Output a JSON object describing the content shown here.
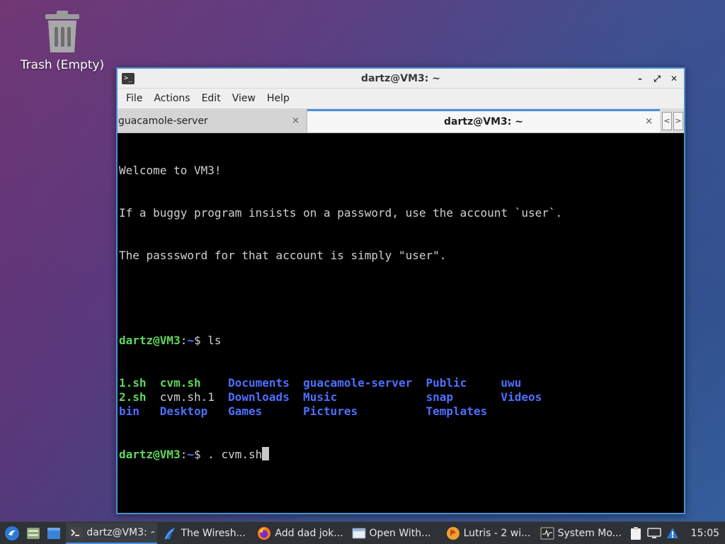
{
  "desktop": {
    "icons": [
      {
        "label": "Trash (Empty)",
        "icon": "trash-icon"
      }
    ]
  },
  "window": {
    "title": "dartz@VM3: ~",
    "controls": [
      "minimize",
      "maximize",
      "close"
    ],
    "menu": [
      "File",
      "Actions",
      "Edit",
      "View",
      "Help"
    ],
    "tabs": [
      {
        "label": "guacamole-server",
        "active": false
      },
      {
        "label": "dartz@VM3: ~",
        "active": true
      }
    ]
  },
  "terminal": {
    "welcome": [
      "Welcome to VM3!",
      "If a buggy program insists on a password, use the account `user`.",
      "The passsword for that account is simply \"user\"."
    ],
    "prompt_user": "dartz@VM3",
    "prompt_sep": ":",
    "prompt_path": "~",
    "prompt_symbol": "$ ",
    "command1": "ls",
    "ls_rows": [
      [
        {
          "t": "1.sh",
          "k": "exe"
        },
        {
          "t": "cvm.sh",
          "k": "exe"
        },
        {
          "t": "Documents",
          "k": "dir"
        },
        {
          "t": "guacamole-server",
          "k": "dir"
        },
        {
          "t": "Public",
          "k": "dir"
        },
        {
          "t": "uwu",
          "k": "dir"
        }
      ],
      [
        {
          "t": "2.sh",
          "k": "exe"
        },
        {
          "t": "cvm.sh.1",
          "k": "plain"
        },
        {
          "t": "Downloads",
          "k": "dir"
        },
        {
          "t": "Music",
          "k": "dir"
        },
        {
          "t": "snap",
          "k": "dir"
        },
        {
          "t": "Videos",
          "k": "dir"
        }
      ],
      [
        {
          "t": "bin",
          "k": "dir"
        },
        {
          "t": "Desktop",
          "k": "dir"
        },
        {
          "t": "Games",
          "k": "dir"
        },
        {
          "t": "Pictures",
          "k": "dir"
        },
        {
          "t": "Templates",
          "k": "dir"
        },
        {
          "t": "",
          "k": "plain"
        }
      ]
    ],
    "command2": ". cvm.sh"
  },
  "taskbar": {
    "tasks": [
      {
        "label": "dartz@VM3: ~",
        "icon": "terminal-icon",
        "active": true
      },
      {
        "label": "The Wiresh...",
        "icon": "wireshark-icon",
        "active": false
      },
      {
        "label": "Add dad jok...",
        "icon": "firefox-icon",
        "active": false
      },
      {
        "label": "Open With...",
        "icon": "window-icon",
        "active": false
      },
      {
        "label": "Lutris - 2 wi...",
        "icon": "lutris-icon",
        "active": false
      },
      {
        "label": "System Mo...",
        "icon": "system-monitor-icon",
        "active": false
      }
    ],
    "clock": "15:05"
  },
  "colors": {
    "accent": "#4a90d9",
    "prompt_user": "#5fd75f",
    "directory": "#4f6fff",
    "terminal_bg": "#000000",
    "taskbar_bg": "#2e3136"
  }
}
